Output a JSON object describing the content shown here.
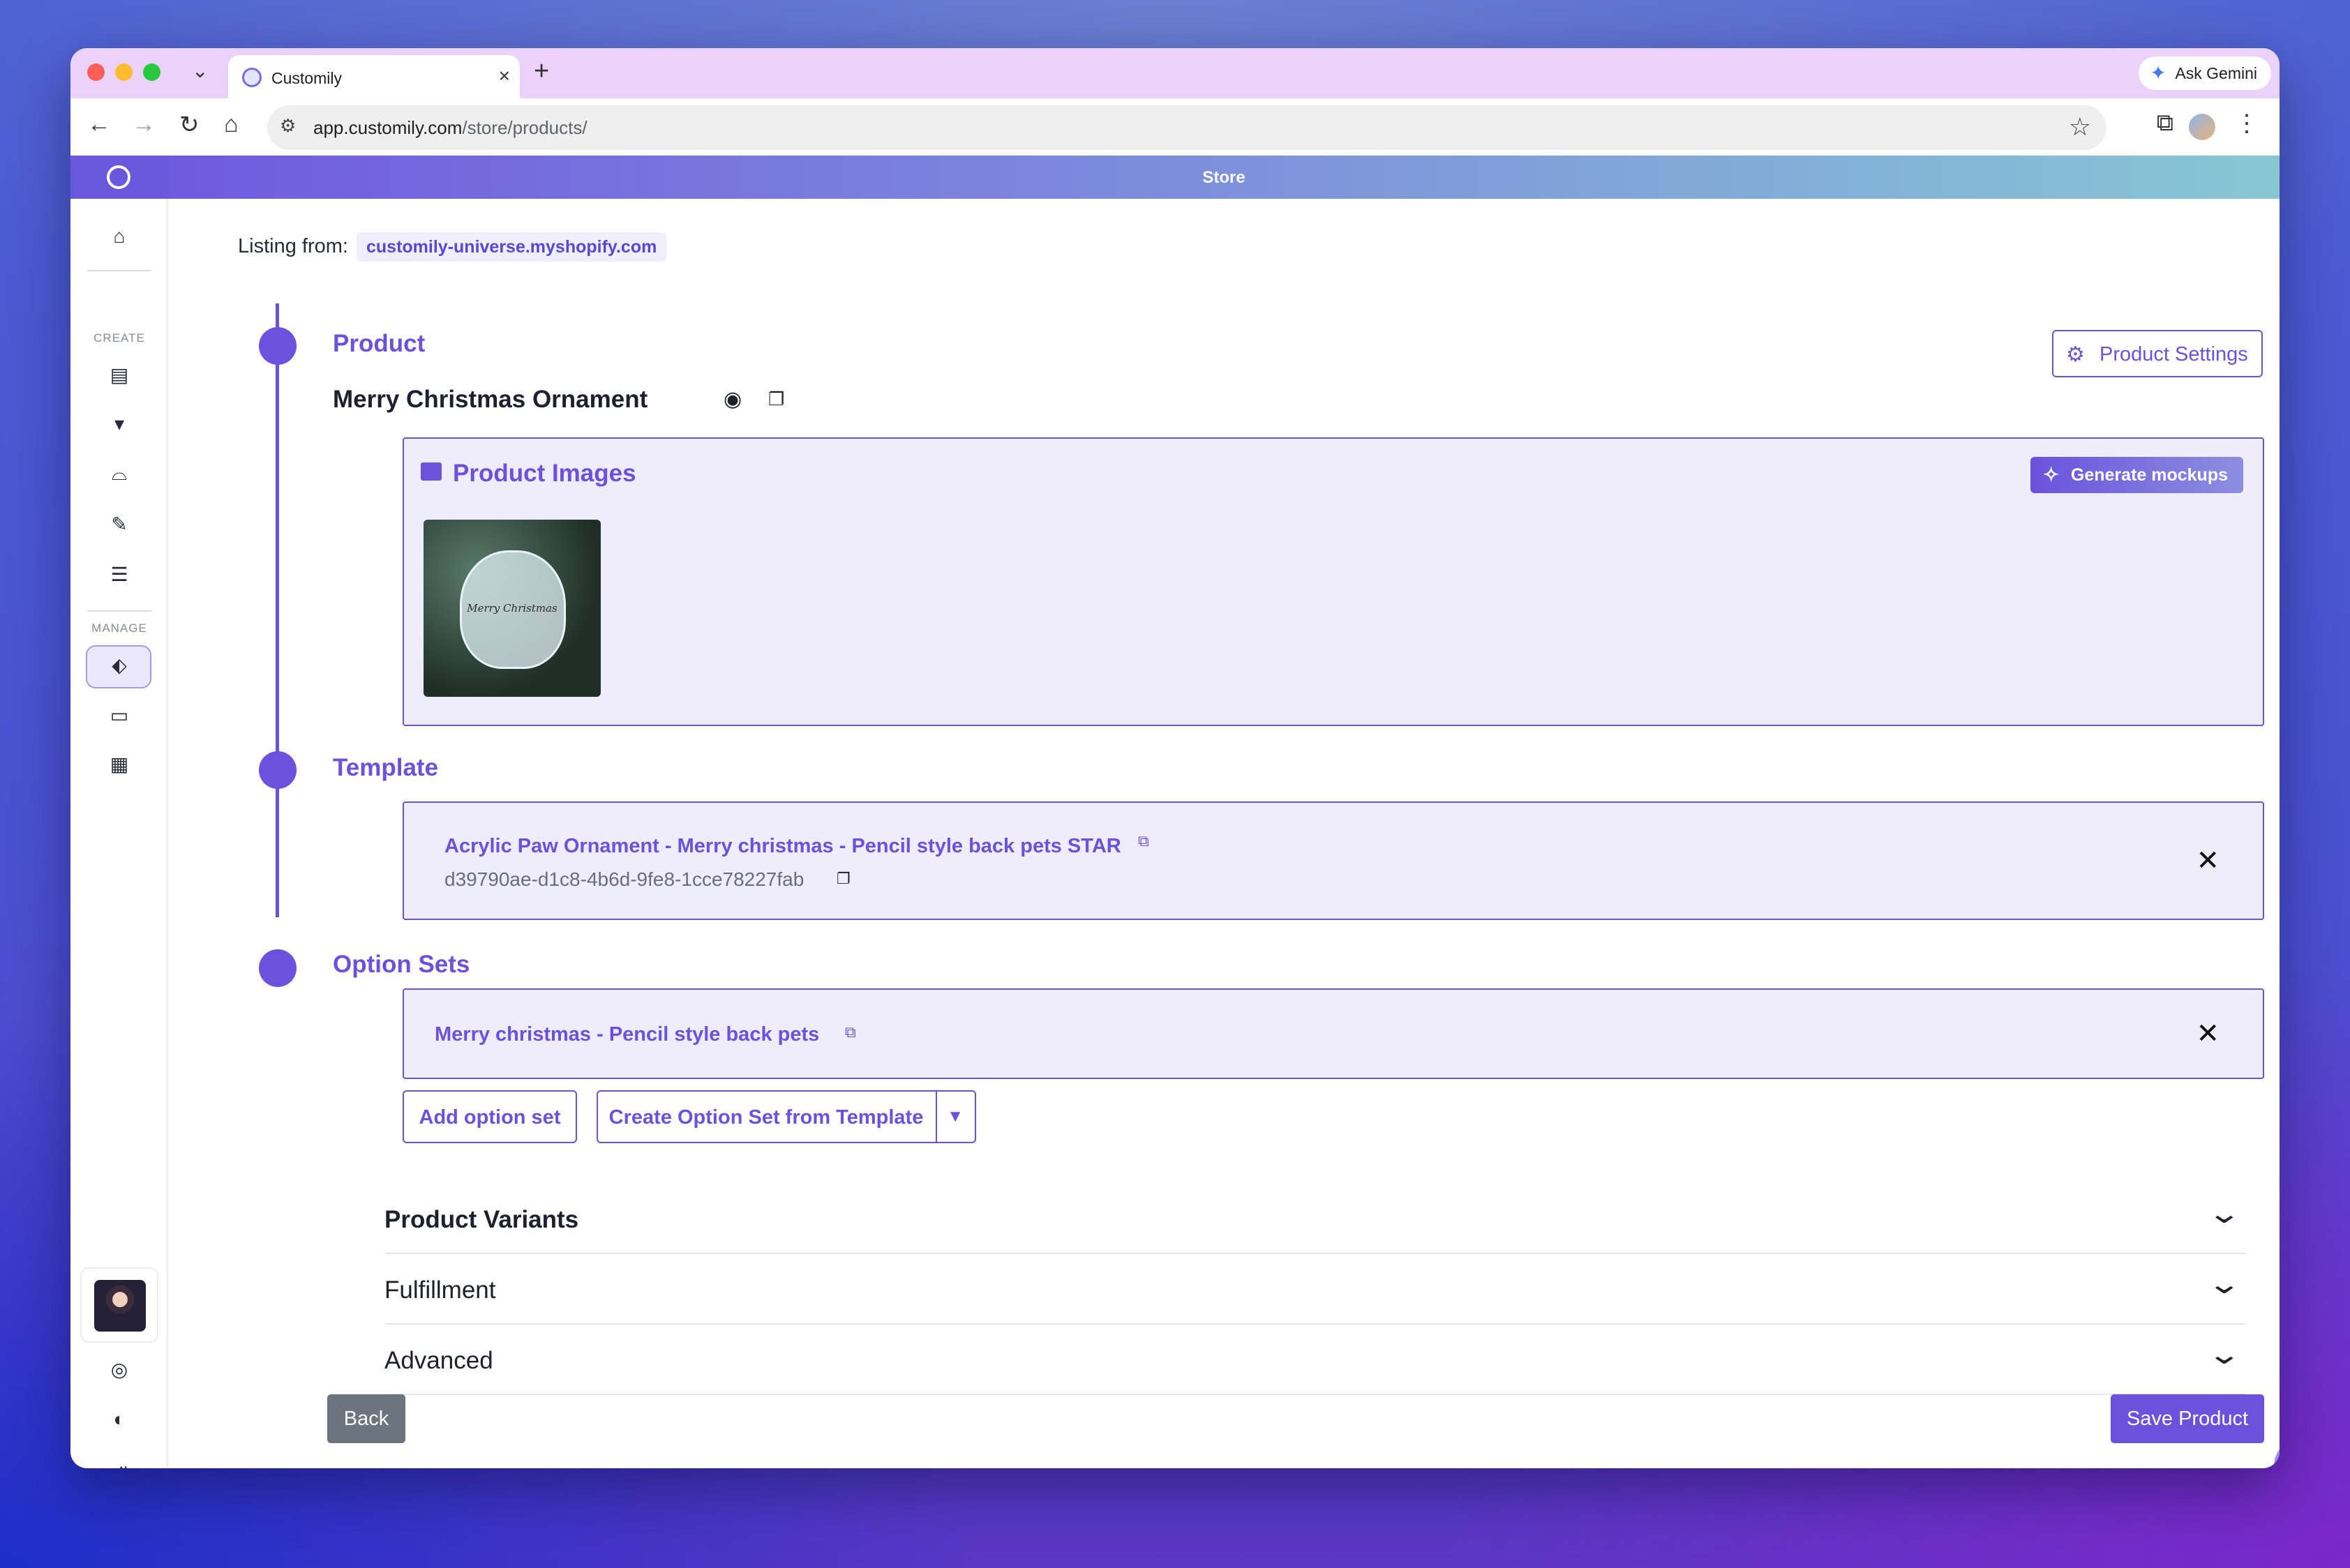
{
  "browser": {
    "tab_title": "Customily",
    "new_tab_icon": "+",
    "tab_close_icon": "×",
    "gemini_label": "Ask Gemini",
    "url_host": "app.customily.com",
    "url_path": "/store/products/"
  },
  "app": {
    "header_title": "Store"
  },
  "sidebar": {
    "create_label": "CREATE",
    "manage_label": "MANAGE"
  },
  "page": {
    "listing_label": "Listing from:",
    "listing_store": "customily-universe.myshopify.com",
    "product_section_title": "Product",
    "product_settings_label": "Product Settings",
    "product_name": "Merry Christmas Ornament",
    "images_title": "Product Images",
    "generate_mockups_label": "Generate mockups",
    "thumbnail_caption": "Merry Christmas",
    "template_section_title": "Template",
    "template_name": "Acrylic Paw Ornament - Merry christmas - Pencil style back pets STAR",
    "template_id": "d39790ae-d1c8-4b6d-9fe8-1cce78227fab",
    "option_sets_title": "Option Sets",
    "option_set_name": "Merry christmas - Pencil style back pets",
    "add_option_set_label": "Add option set",
    "create_option_set_label": "Create Option Set from Template",
    "accordions": [
      {
        "label": "Product Variants"
      },
      {
        "label": "Fulfillment"
      },
      {
        "label": "Advanced"
      }
    ],
    "back_label": "Back",
    "save_label": "Save Product"
  },
  "colors": {
    "accent": "#6a52dc",
    "panel_bg": "#efecfb",
    "back_button": "#6c757d"
  }
}
